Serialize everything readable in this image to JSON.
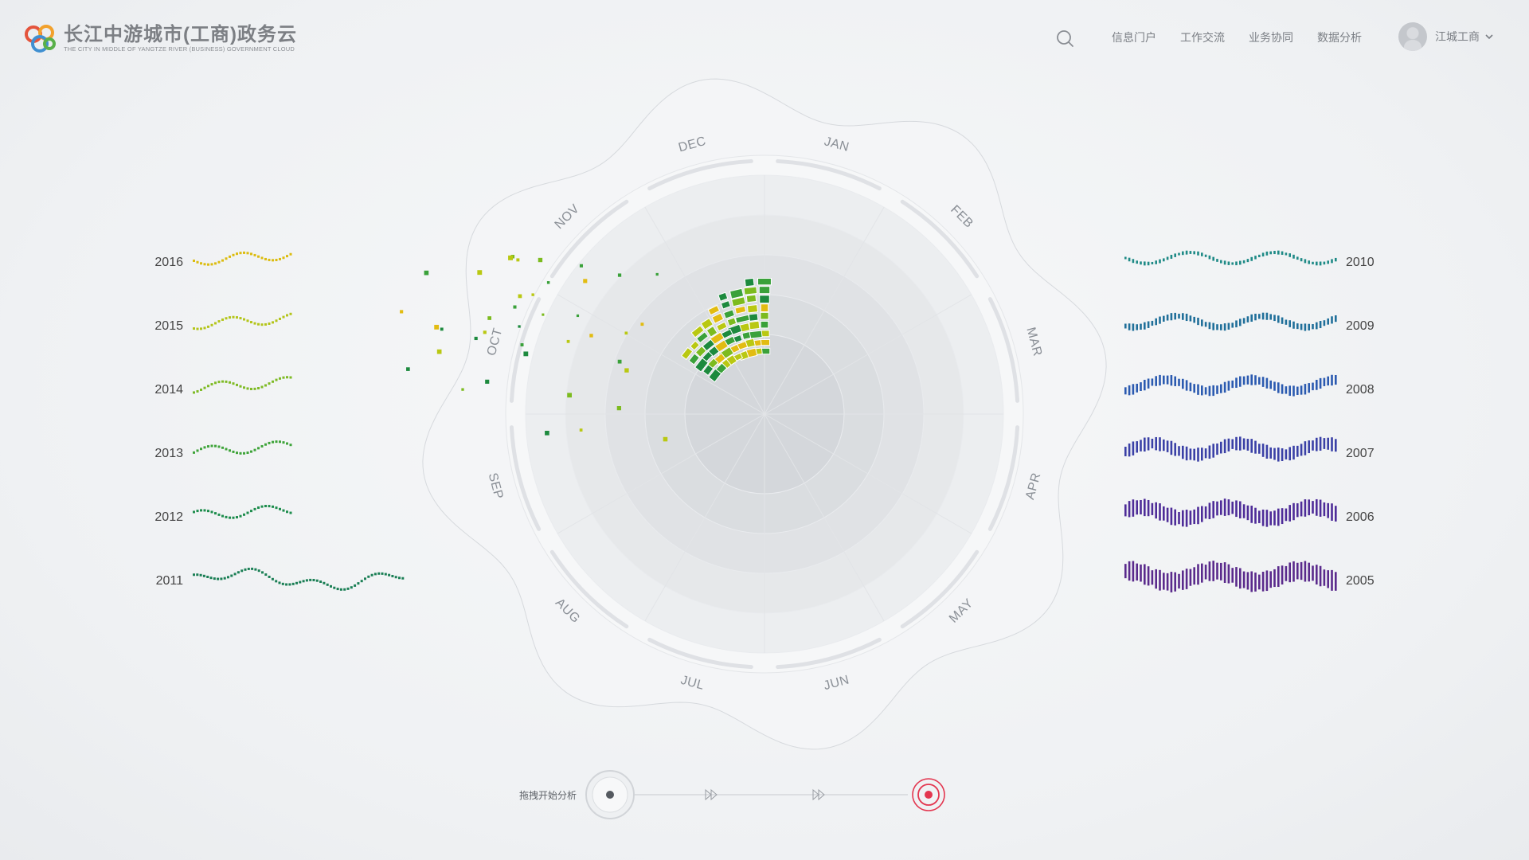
{
  "app": {
    "title": "长江中游城市(工商)政务云",
    "subtitle": "THE CITY IN MIDDLE OF YANGTZE RIVER (BUSINESS) GOVERNMENT CLOUD"
  },
  "nav": {
    "items": [
      "信息门户",
      "工作交流",
      "业务协同",
      "数据分析"
    ]
  },
  "user": {
    "name": "江城工商"
  },
  "icons": {
    "search": "search-icon",
    "dropdown": "chevron-down-icon",
    "logo": "logo-icon",
    "fast_forward": "fast-forward-icon",
    "target": "target-icon"
  },
  "colors": {
    "accent_red": "#e3364f",
    "green": "#1d8a3e",
    "yellow_green": "#b9c812",
    "yellow": "#e2bc12",
    "teal": "#1a8a87",
    "blue": "#2d5fb0",
    "purple": "#5a2c8f"
  },
  "months": [
    "JAN",
    "FEB",
    "MAR",
    "APR",
    "MAY",
    "JUN",
    "JUL",
    "AUG",
    "SEP",
    "OCT",
    "NOV",
    "DEC"
  ],
  "left_years": [
    "2016",
    "2015",
    "2014",
    "2013",
    "2012",
    "2011"
  ],
  "right_years": [
    "2010",
    "2009",
    "2008",
    "2007",
    "2006",
    "2005"
  ],
  "controls": {
    "drag_label": "拖拽开始分析"
  }
}
